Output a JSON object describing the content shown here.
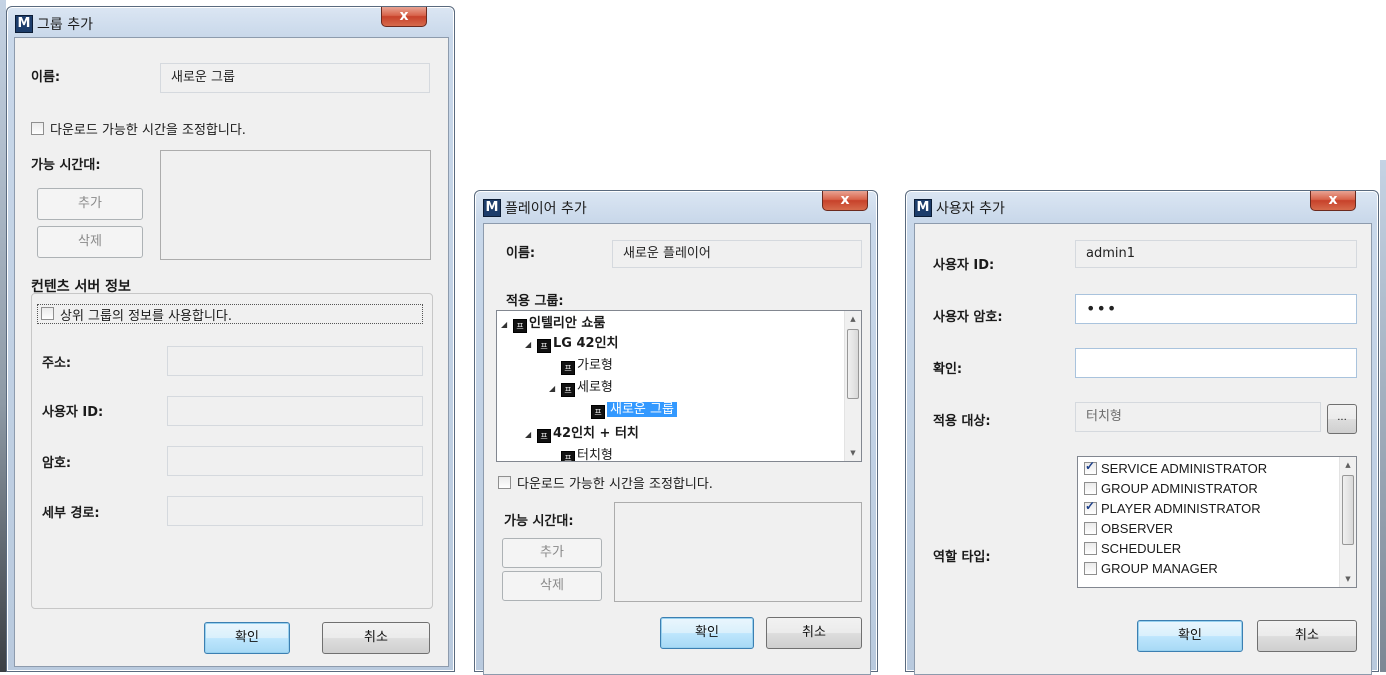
{
  "group_dialog": {
    "title": "그룹 추가",
    "name_label": "이름:",
    "name_value": "새로운 그룹",
    "download_time_check_label": "다운로드 가능한 시간을 조정합니다.",
    "download_time_checked": false,
    "time_slots_label": "가능 시간대:",
    "add_button": "추가",
    "delete_button": "삭제",
    "content_server_section": "컨텐츠 서버 정보",
    "use_parent_info_label": "상위 그룹의 정보를 사용합니다.",
    "use_parent_info_checked": false,
    "address_label": "주소:",
    "user_id_label": "사용자 ID:",
    "password_label": "암호:",
    "sub_path_label": "세부 경로:",
    "ok_button": "확인",
    "cancel_button": "취소",
    "close_glyph": "x"
  },
  "player_dialog": {
    "title": "플레이어 추가",
    "name_label": "이름:",
    "name_value": "새로운 플레이어",
    "apply_group_label": "적용 그룹:",
    "tree": [
      {
        "label": "인텔리안 쇼룸",
        "expanded": true
      },
      {
        "label": "LG 42인치",
        "expanded": true
      },
      {
        "label": "가로형"
      },
      {
        "label": "세로형",
        "expanded": true
      },
      {
        "label": "새로운 그룹",
        "selected": true
      },
      {
        "label": "42인치 + 터치",
        "expanded": true
      },
      {
        "label": "터치형"
      }
    ],
    "group_icon_text": "프",
    "download_time_check_label": "다운로드 가능한 시간을 조정합니다.",
    "time_slots_label": "가능 시간대:",
    "add_button": "추가",
    "delete_button": "삭제",
    "ok_button": "확인",
    "cancel_button": "취소",
    "close_glyph": "x"
  },
  "user_dialog": {
    "title": "사용자 추가",
    "user_id_label": "사용자 ID:",
    "user_id_value": "admin1",
    "password_label": "사용자 암호:",
    "password_value": "•••",
    "confirm_label": "확인:",
    "confirm_value": "",
    "apply_target_label": "적용 대상:",
    "apply_target_value": "터치형",
    "browse_button": "...",
    "role_type_label": "역할 타입:",
    "roles": [
      {
        "label": "SERVICE ADMINISTRATOR",
        "checked": true
      },
      {
        "label": "GROUP ADMINISTRATOR",
        "checked": false
      },
      {
        "label": "PLAYER ADMINISTRATOR",
        "checked": true
      },
      {
        "label": "OBSERVER",
        "checked": false
      },
      {
        "label": "SCHEDULER",
        "checked": false
      },
      {
        "label": "GROUP MANAGER",
        "checked": false
      }
    ],
    "ok_button": "확인",
    "cancel_button": "취소",
    "close_glyph": "x"
  },
  "app_icon_letter": "M"
}
